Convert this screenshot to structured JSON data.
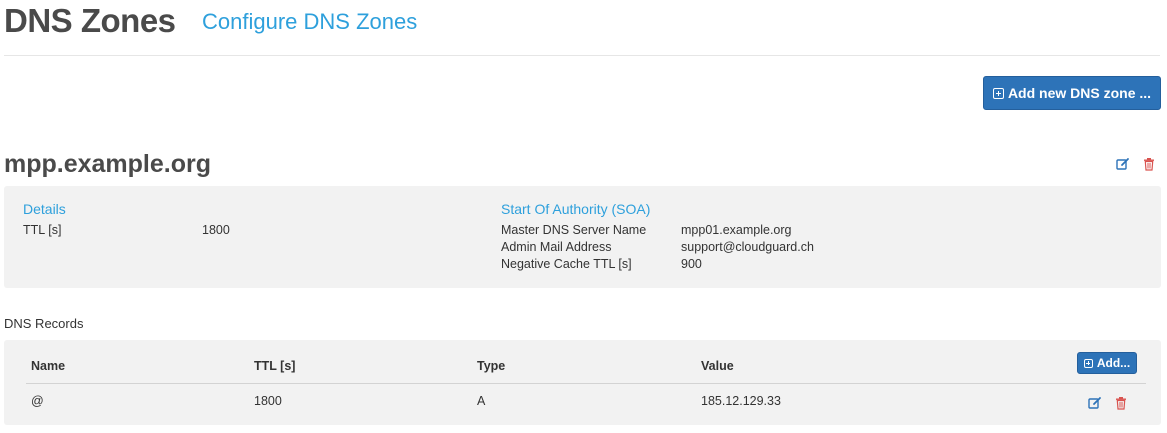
{
  "header": {
    "title": "DNS Zones",
    "subtitle": "Configure DNS Zones"
  },
  "actions": {
    "add_zone_label": "Add new DNS zone ..."
  },
  "zone": {
    "name": "mpp.example.org",
    "details": {
      "heading": "Details",
      "ttl_label": "TTL [s]",
      "ttl_value": "1800"
    },
    "soa": {
      "heading": "Start Of Authority (SOA)",
      "rows": [
        {
          "label": "Master DNS Server Name",
          "value": "mpp01.example.org"
        },
        {
          "label": "Admin Mail Address",
          "value": "support@cloudguard.ch"
        },
        {
          "label": "Negative Cache TTL [s]",
          "value": "900"
        }
      ]
    }
  },
  "records": {
    "title": "DNS Records",
    "add_label": "Add...",
    "columns": [
      "Name",
      "TTL [s]",
      "Type",
      "Value"
    ],
    "rows": [
      {
        "name": "@",
        "ttl": "1800",
        "type": "A",
        "value": "185.12.129.33"
      }
    ]
  },
  "icons": {
    "edit": "edit-icon",
    "delete": "trash-icon"
  },
  "colors": {
    "accent": "#2ea0dc",
    "primary_button": "#2d73b8",
    "danger": "#d9534f",
    "panel_bg": "#f2f2f2"
  }
}
